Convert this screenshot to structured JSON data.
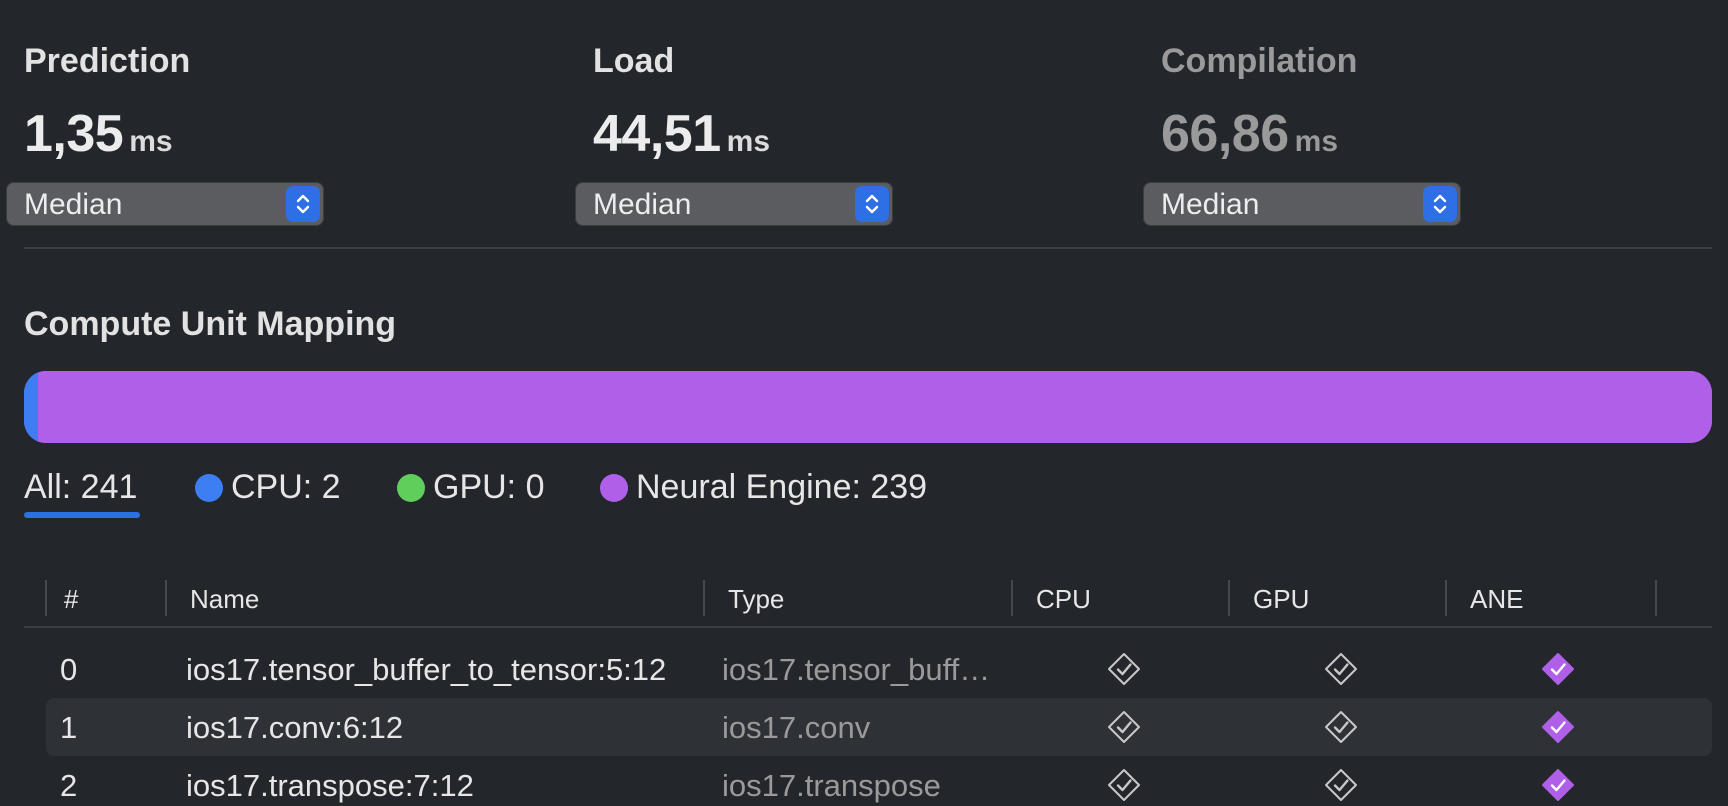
{
  "metrics": [
    {
      "title": "Prediction",
      "value": "1,35",
      "unit": "ms",
      "aggregation": "Median",
      "dimmed": false
    },
    {
      "title": "Load",
      "value": "44,51",
      "unit": "ms",
      "aggregation": "Median",
      "dimmed": false
    },
    {
      "title": "Compilation",
      "value": "66,86",
      "unit": "ms",
      "aggregation": "Median",
      "dimmed": true
    }
  ],
  "compute_unit_mapping": {
    "title": "Compute Unit Mapping",
    "distribution": {
      "cpu": 2,
      "gpu": 0,
      "neural_engine": 239,
      "total": 241
    },
    "filters": {
      "all": "All: 241",
      "cpu": "CPU: 2",
      "gpu": "GPU: 0",
      "ane": "Neural Engine: 239",
      "selected": "all"
    }
  },
  "colors": {
    "cpu": "#3d7ff2",
    "gpu": "#5fce5a",
    "ane": "#b060e8",
    "accent": "#2f6fe5"
  },
  "table": {
    "headers": {
      "index": "#",
      "name": "Name",
      "type": "Type",
      "cpu": "CPU",
      "gpu": "GPU",
      "ane": "ANE"
    },
    "rows": [
      {
        "index": "0",
        "name": "ios17.tensor_buffer_to_tensor:5:12",
        "type": "ios17.tensor_buff…",
        "cpu": false,
        "gpu": false,
        "ane": true
      },
      {
        "index": "1",
        "name": "ios17.conv:6:12",
        "type": "ios17.conv",
        "cpu": false,
        "gpu": false,
        "ane": true
      },
      {
        "index": "2",
        "name": "ios17.transpose:7:12",
        "type": "ios17.transpose",
        "cpu": false,
        "gpu": false,
        "ane": true
      }
    ]
  }
}
